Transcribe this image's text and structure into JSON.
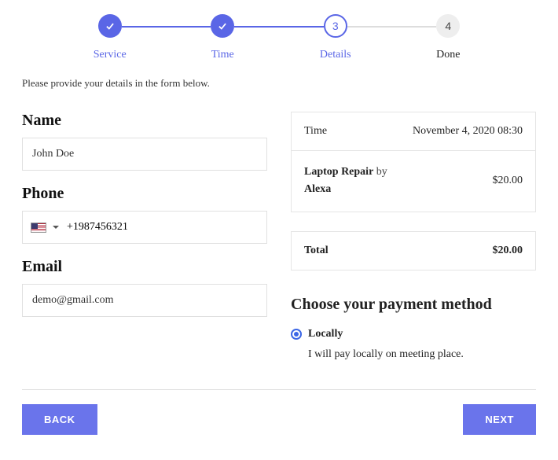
{
  "stepper": {
    "steps": [
      {
        "label": "Service",
        "state": "completed"
      },
      {
        "label": "Time",
        "state": "completed"
      },
      {
        "label": "Details",
        "state": "current",
        "number": "3"
      },
      {
        "label": "Done",
        "state": "future",
        "number": "4"
      }
    ]
  },
  "intro": "Please provide your details in the form below.",
  "form": {
    "name": {
      "label": "Name",
      "value": "John Doe"
    },
    "phone": {
      "label": "Phone",
      "value": "+1987456321",
      "country": "US"
    },
    "email": {
      "label": "Email",
      "value": "demo@gmail.com"
    }
  },
  "summary": {
    "time_label": "Time",
    "time_value": "November 4, 2020 08:30",
    "service_name": "Laptop Repair",
    "by_word": "by",
    "provider": "Alexa",
    "service_price": "$20.00",
    "total_label": "Total",
    "total_value": "$20.00"
  },
  "payment": {
    "heading": "Choose your payment method",
    "option_label": "Locally",
    "option_desc": "I will pay locally on meeting place."
  },
  "buttons": {
    "back": "BACK",
    "next": "NEXT"
  }
}
